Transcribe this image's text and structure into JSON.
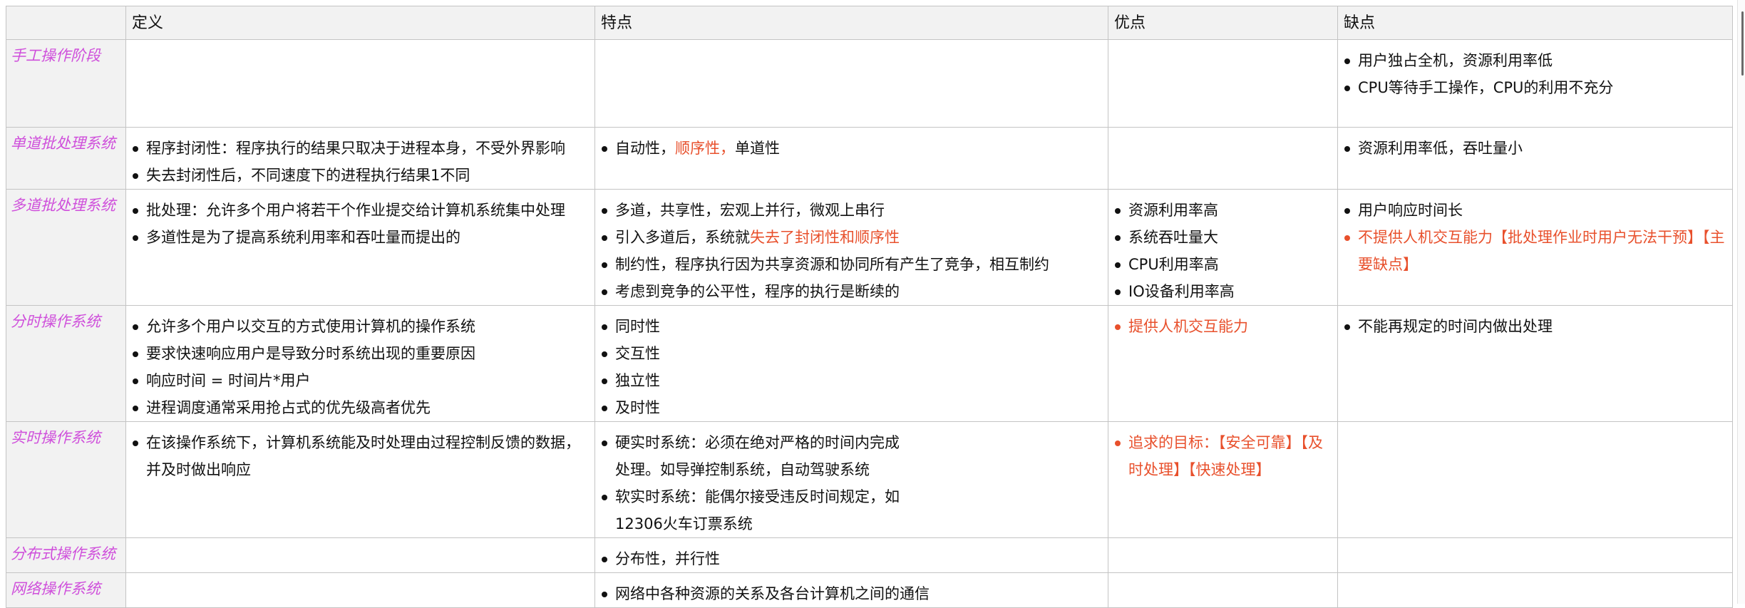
{
  "headers": [
    "",
    "定义",
    "特点",
    "优点",
    "缺点"
  ],
  "rows": [
    {
      "label": "手工操作阶段",
      "definition": [],
      "features": [],
      "pros": [],
      "cons": [
        "用户独占全机，资源利用率低",
        "CPU等待手工操作，CPU的利用不充分"
      ]
    },
    {
      "label": "单道批处理系统",
      "definition": [
        "程序封闭性：程序执行的结果只取决于进程本身，不受外界影响",
        "失去封闭性后，不同速度下的进程执行结果1不同"
      ],
      "features": [
        {
          "parts": [
            "自动性，",
            "顺序性，",
            "单道性"
          ]
        }
      ],
      "pros": [],
      "cons": [
        "资源利用率低，吞吐量小"
      ]
    },
    {
      "label": "多道批处理系统",
      "definition": [
        "批处理：允许多个用户将若干个作业提交给计算机系统集中处理",
        "多道性是为了提高系统利用率和吞吐量而提出的"
      ],
      "features": [
        "多道，共享性，宏观上并行，微观上串行",
        {
          "parts": [
            "引入多道后，系统就",
            "失去了封闭性和顺序性"
          ]
        },
        "制约性，程序执行因为共享资源和协同所有产生了竞争，相互制约",
        "考虑到竞争的公平性，程序的执行是断续的"
      ],
      "pros": [
        "资源利用率高",
        "系统吞吐量大",
        "CPU利用率高",
        "IO设备利用率高"
      ],
      "cons": [
        "用户响应时间长",
        "不提供人机交互能力【批处理作业时用户无法干预】【主要缺点】"
      ]
    },
    {
      "label": "分时操作系统",
      "definition": [
        "允许多个用户以交互的方式使用计算机的操作系统",
        "要求快速响应用户是导致分时系统出现的重要原因",
        "响应时间 = 时间片*用户",
        "进程调度通常采用抢占式的优先级高者优先"
      ],
      "features": [
        "同时性",
        "交互性",
        "独立性",
        "及时性"
      ],
      "pros": [
        "提供人机交互能力"
      ],
      "cons": [
        "不能再规定的时间内做出处理"
      ]
    },
    {
      "label": "实时操作系统",
      "definition": [
        "在该操作系统下，计算机系统能及时处理由过程控制反馈的数据，并及时做出响应"
      ],
      "features": [
        "硬实时系统：必须在绝对严格的时间内完成处理。如导弹控制系统，自动驾驶系统",
        "软实时系统：能偶尔接受违反时间规定，如12306火车订票系统"
      ],
      "pros": [
        "追求的目标：【安全可靠】【及时处理】【快速处理】"
      ],
      "cons": []
    },
    {
      "label": "分布式操作系统",
      "definition": [],
      "features": [
        "分布性，并行性"
      ],
      "pros": [],
      "cons": []
    },
    {
      "label": "网络操作系统",
      "definition": [],
      "features": [
        "网络中各种资源的关系及各台计算机之间的通信"
      ],
      "pros": [],
      "cons": []
    }
  ],
  "colors": {
    "row_label": "#cf4fdb",
    "highlight": "#e8502c",
    "header_bg": "#f2f2f2",
    "border": "#c4c4c4"
  }
}
